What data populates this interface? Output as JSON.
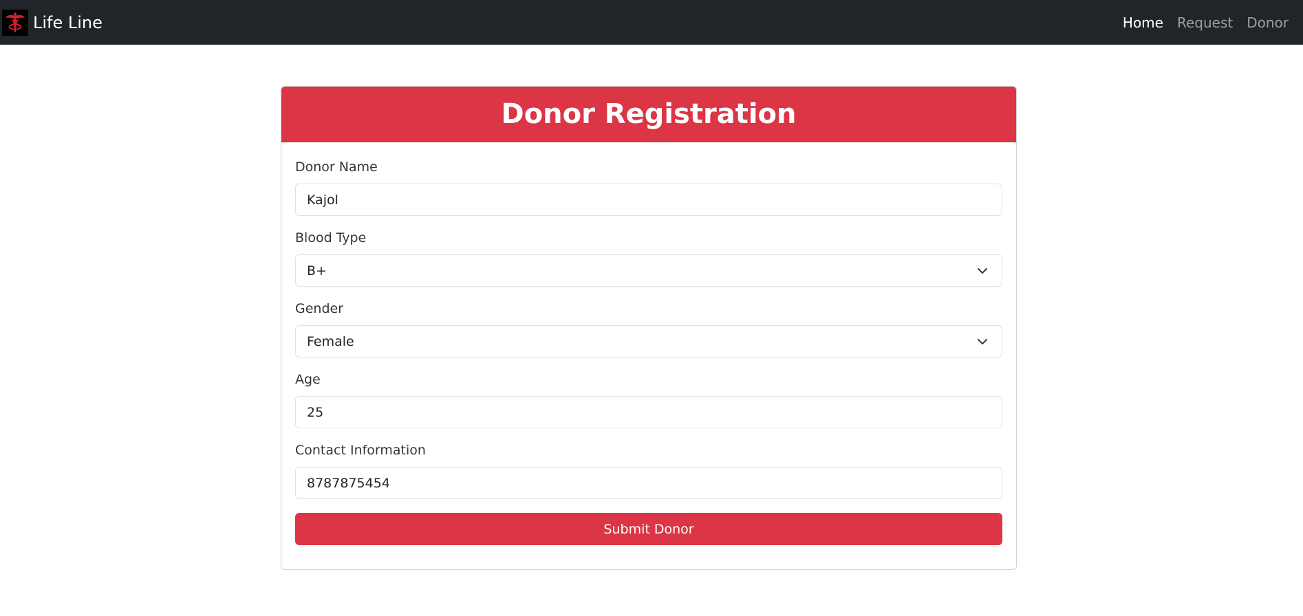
{
  "navbar": {
    "brand_name": "Life Line",
    "logo_icon": "caduceus-icon",
    "links": [
      {
        "label": "Home",
        "active": true
      },
      {
        "label": "Request",
        "active": false
      },
      {
        "label": "Donor",
        "active": false
      }
    ]
  },
  "form": {
    "title": "Donor Registration",
    "fields": {
      "donor_name": {
        "label": "Donor Name",
        "value": "Kajol"
      },
      "blood_type": {
        "label": "Blood Type",
        "value": "B+"
      },
      "gender": {
        "label": "Gender",
        "value": "Female"
      },
      "age": {
        "label": "Age",
        "value": "25"
      },
      "contact": {
        "label": "Contact Information",
        "value": "8787875454"
      }
    },
    "submit_label": "Submit Donor"
  },
  "colors": {
    "navbar_bg": "#212529",
    "accent": "#dc3545",
    "page_bg": "#ffffff"
  }
}
